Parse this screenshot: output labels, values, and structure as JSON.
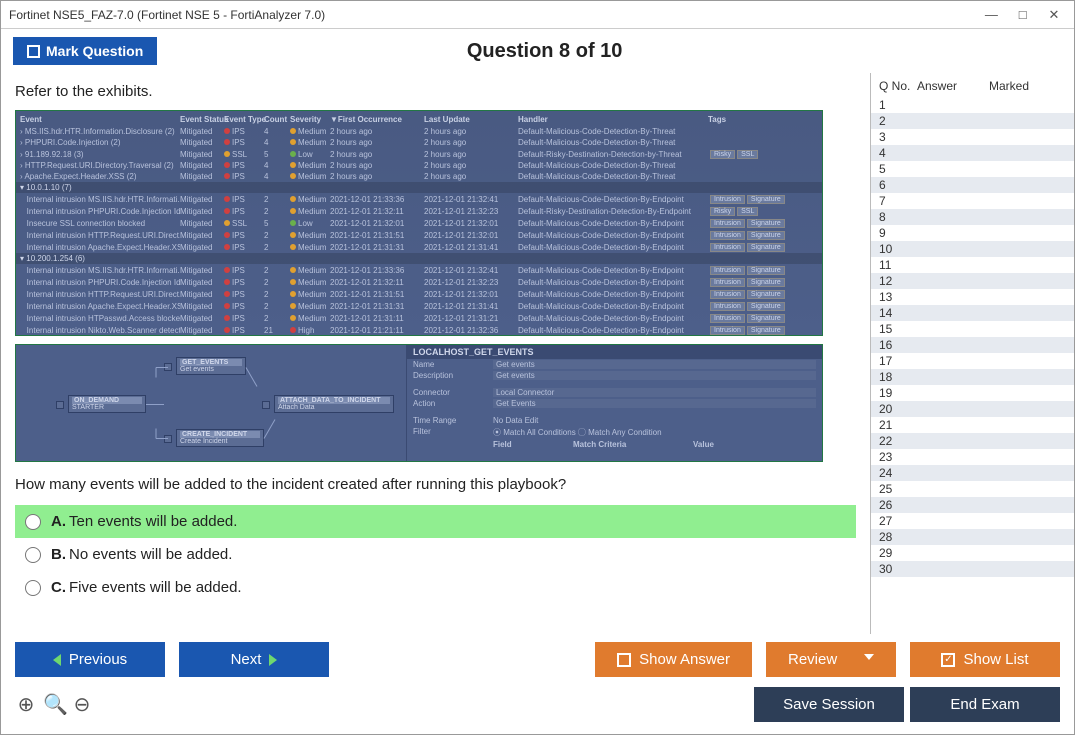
{
  "window": {
    "title": "Fortinet NSE5_FAZ-7.0 (Fortinet NSE 5 - FortiAnalyzer 7.0)"
  },
  "topbar": {
    "mark": "Mark Question",
    "title": "Question 8 of 10"
  },
  "prompt": "Refer to the exhibits.",
  "question": "How many events will be added to the incident created after running this playbook?",
  "answers": {
    "a": {
      "letter": "A.",
      "text": "Ten events will be added."
    },
    "b": {
      "letter": "B.",
      "text": "No events will be added."
    },
    "c": {
      "letter": "C.",
      "text": "Five events will be added."
    }
  },
  "buttons": {
    "previous": "Previous",
    "next": "Next",
    "show_answer": "Show Answer",
    "review": "Review",
    "show_list": "Show List",
    "save_session": "Save Session",
    "end_exam": "End Exam"
  },
  "sidebar": {
    "qno": "Q No.",
    "answer": "Answer",
    "marked": "Marked",
    "count": 30
  },
  "exhibit1": {
    "headers": [
      "Event",
      "Event Status",
      "Event Type",
      "Count",
      "Severity",
      "▼First Occurrence",
      "Last Update",
      "Handler",
      "Tags"
    ],
    "sev_medium": "Medium",
    "sev_low": "Low",
    "sev_high": "High",
    "type_ips": "IPS",
    "type_ssl": "SSL",
    "status": "Mitigated",
    "rows_top": [
      {
        "name": "MS.IIS.hdr.HTR.Information.Disclosure (2)",
        "sev": "Medium",
        "t1": "2 hours ago",
        "t2": "2 hours ago",
        "h": "Default-Malicious-Code-Detection-By-Threat"
      },
      {
        "name": "PHPURI.Code.Injection (2)",
        "sev": "Medium",
        "t1": "2 hours ago",
        "t2": "2 hours ago",
        "h": "Default-Malicious-Code-Detection-By-Threat"
      },
      {
        "name": "91.189.92.18 (3)",
        "type": "SSL",
        "sev": "Low",
        "t1": "2 hours ago",
        "t2": "2 hours ago",
        "h": "Default-Risky-Destination-Detection-by-Threat",
        "tags": [
          "Risky",
          "SSL"
        ]
      },
      {
        "name": "HTTP.Request.URI.Directory.Traversal (2)",
        "sev": "Medium",
        "t1": "2 hours ago",
        "t2": "2 hours ago",
        "h": "Default-Malicious-Code-Detection-By-Threat"
      },
      {
        "name": "Apache.Expect.Header.XSS (2)",
        "sev": "Medium",
        "t1": "2 hours ago",
        "t2": "2 hours ago",
        "h": "Default-Malicious-Code-Detection-By-Threat"
      }
    ],
    "group1": "10.0.1.10 (7)",
    "rows_g1": [
      {
        "name": "Internal intrusion MS.IIS.hdr.HTR.Informati..",
        "sev": "Medium",
        "t1": "2021-12-01 21:33:36",
        "t2": "2021-12-01 21:32:41",
        "h": "Default-Malicious-Code-Detection-By-Endpoint",
        "tags": [
          "Intrusion",
          "Signature"
        ]
      },
      {
        "name": "Internal intrusion PHPURI.Code.Injection Id..",
        "sev": "Medium",
        "t1": "2021-12-01 21:32:11",
        "t2": "2021-12-01 21:32:23",
        "h": "Default-Risky-Destination-Detection-By-Endpoint",
        "tags": [
          "Risky",
          "SSL"
        ]
      },
      {
        "name": "Insecure SSL connection blocked",
        "type": "SSL",
        "sev": "Low",
        "t1": "2021-12-01 21:32:01",
        "t2": "2021-12-01 21:32:01",
        "h": "Default-Malicious-Code-Detection-By-Endpoint",
        "tags": [
          "Intrusion",
          "Signature"
        ]
      },
      {
        "name": "Internal intrusion HTTP.Request.URI.Direct..",
        "sev": "Medium",
        "t1": "2021-12-01 21:31:51",
        "t2": "2021-12-01 21:32:01",
        "h": "Default-Malicious-Code-Detection-By-Endpoint",
        "tags": [
          "Intrusion",
          "Signature"
        ]
      },
      {
        "name": "Internal intrusion Apache.Expect.Header.XS..",
        "sev": "Medium",
        "t1": "2021-12-01 21:31:31",
        "t2": "2021-12-01 21:31:41",
        "h": "Default-Malicious-Code-Detection-By-Endpoint",
        "tags": [
          "Intrusion",
          "Signature"
        ]
      }
    ],
    "group2": "10.200.1.254 (6)",
    "rows_g2": [
      {
        "name": "Internal intrusion MS.IIS.hdr.HTR.Informati..",
        "sev": "Medium",
        "t1": "2021-12-01 21:33:36",
        "t2": "2021-12-01 21:32:41",
        "h": "Default-Malicious-Code-Detection-By-Endpoint",
        "tags": [
          "Intrusion",
          "Signature"
        ]
      },
      {
        "name": "Internal intrusion PHPURI.Code.Injection Id..",
        "sev": "Medium",
        "t1": "2021-12-01 21:32:11",
        "t2": "2021-12-01 21:32:23",
        "h": "Default-Malicious-Code-Detection-By-Endpoint",
        "tags": [
          "Intrusion",
          "Signature"
        ]
      },
      {
        "name": "Internal intrusion HTTP.Request.URI.Direct..",
        "sev": "Medium",
        "t1": "2021-12-01 21:31:51",
        "t2": "2021-12-01 21:32:01",
        "h": "Default-Malicious-Code-Detection-By-Endpoint",
        "tags": [
          "Intrusion",
          "Signature"
        ]
      },
      {
        "name": "Internal intrusion Apache.Expect.Header.XS..",
        "sev": "Medium",
        "t1": "2021-12-01 21:31:31",
        "t2": "2021-12-01 21:31:41",
        "h": "Default-Malicious-Code-Detection-By-Endpoint",
        "tags": [
          "Intrusion",
          "Signature"
        ]
      },
      {
        "name": "Internal intrusion HTPasswd.Access blocked",
        "sev": "Medium",
        "t1": "2021-12-01 21:31:11",
        "t2": "2021-12-01 21:31:21",
        "h": "Default-Malicious-Code-Detection-By-Endpoint",
        "tags": [
          "Intrusion",
          "Signature"
        ]
      },
      {
        "name": "Internal intrusion Nikto.Web.Scanner detect..",
        "sev": "High",
        "t1": "2021-12-01 21:21:11",
        "t2": "2021-12-01 21:32:36",
        "h": "Default-Malicious-Code-Detection-By-Endpoint",
        "tags": [
          "Intrusion",
          "Signature"
        ]
      }
    ]
  },
  "exhibit2": {
    "nodes": {
      "starter": {
        "title": "ON_DEMAND",
        "sub": "STARTER"
      },
      "get_events": {
        "title": "GET_EVENTS",
        "sub": "Get events"
      },
      "attach": {
        "title": "ATTACH_DATA_TO_INCIDENT",
        "sub": "Attach Data"
      },
      "create": {
        "title": "CREATE_INCIDENT",
        "sub": "Create Incident"
      }
    },
    "panel_title": "LOCALHOST_GET_EVENTS",
    "fields": {
      "name_lbl": "Name",
      "name_val": "Get events",
      "desc_lbl": "Description",
      "desc_val": "Get events",
      "conn_lbl": "Connector",
      "conn_val": "Local Connector",
      "action_lbl": "Action",
      "action_val": "Get Events",
      "time_lbl": "Time Range",
      "time_val": "No Data   Edit",
      "filter_lbl": "Filter",
      "filter_val": "⦿ Match All Conditions   ◯ Match Any Condition",
      "field_lbl": "Field",
      "match_lbl": "Match Criteria",
      "value_lbl": "Value"
    }
  }
}
